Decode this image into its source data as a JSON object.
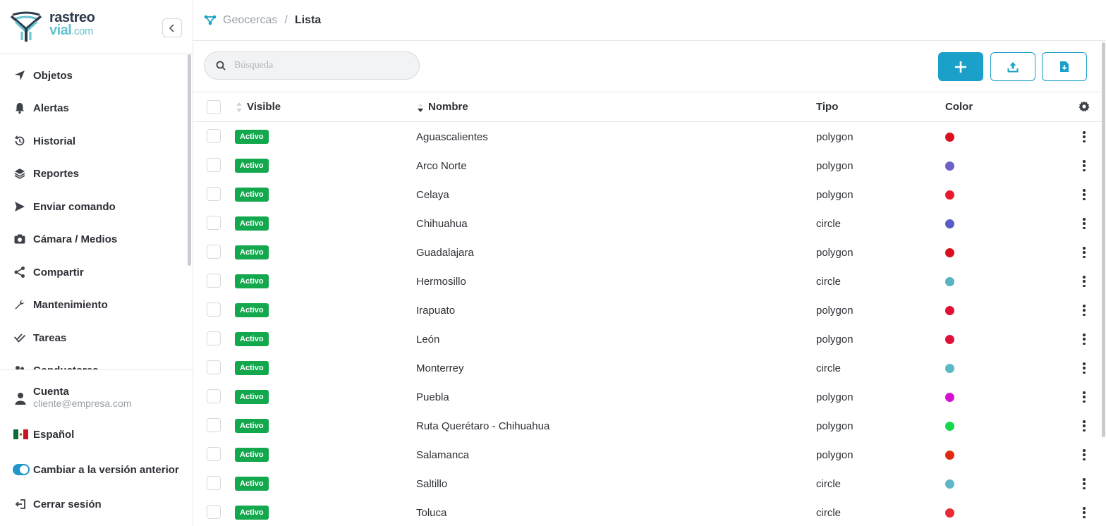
{
  "brand": {
    "line1": "rastreo",
    "line2_main": "vial",
    "line2_suffix": ".com"
  },
  "nav": {
    "items": [
      {
        "label": "Objetos",
        "icon": "location-arrow-icon"
      },
      {
        "label": "Alertas",
        "icon": "bell-icon"
      },
      {
        "label": "Historial",
        "icon": "history-icon"
      },
      {
        "label": "Reportes",
        "icon": "layers-icon"
      },
      {
        "label": "Enviar comando",
        "icon": "send-icon"
      },
      {
        "label": "Cámara / Medios",
        "icon": "camera-icon"
      },
      {
        "label": "Compartir",
        "icon": "share-icon"
      },
      {
        "label": "Mantenimiento",
        "icon": "wrench-icon"
      },
      {
        "label": "Tareas",
        "icon": "double-check-icon"
      },
      {
        "label": "Conductores",
        "icon": "users-icon"
      }
    ]
  },
  "account": {
    "label": "Cuenta",
    "email": "cliente@empresa.com"
  },
  "language": {
    "label": "Español"
  },
  "legacy_toggle": {
    "label": "Cambiar a la versión anterior",
    "on": true
  },
  "logout": {
    "label": "Cerrar sesión"
  },
  "breadcrumb": {
    "section": "Geocercas",
    "separator": "/",
    "page": "Lista"
  },
  "search": {
    "placeholder": "Búsqueda",
    "value": ""
  },
  "columns": {
    "visible": "Visible",
    "name": "Nombre",
    "type": "Tipo",
    "color": "Color"
  },
  "rows": [
    {
      "status": "Activo",
      "name": "Aguascalientes",
      "type": "polygon",
      "color": "#d90f1e"
    },
    {
      "status": "Activo",
      "name": "Arco Norte",
      "type": "polygon",
      "color": "#6a62c6"
    },
    {
      "status": "Activo",
      "name": "Celaya",
      "type": "polygon",
      "color": "#e8182e"
    },
    {
      "status": "Activo",
      "name": "Chihuahua",
      "type": "circle",
      "color": "#5b5cc4"
    },
    {
      "status": "Activo",
      "name": "Guadalajara",
      "type": "polygon",
      "color": "#d90f1e"
    },
    {
      "status": "Activo",
      "name": "Hermosillo",
      "type": "circle",
      "color": "#5bb2c2"
    },
    {
      "status": "Activo",
      "name": "Irapuato",
      "type": "polygon",
      "color": "#e01038"
    },
    {
      "status": "Activo",
      "name": "León",
      "type": "polygon",
      "color": "#e01038"
    },
    {
      "status": "Activo",
      "name": "Monterrey",
      "type": "circle",
      "color": "#5bb8c4"
    },
    {
      "status": "Activo",
      "name": "Puebla",
      "type": "polygon",
      "color": "#d612d0"
    },
    {
      "status": "Activo",
      "name": "Ruta Querétaro - Chihuahua",
      "type": "polygon",
      "color": "#12d84a"
    },
    {
      "status": "Activo",
      "name": "Salamanca",
      "type": "polygon",
      "color": "#e02a10"
    },
    {
      "status": "Activo",
      "name": "Saltillo",
      "type": "circle",
      "color": "#5bb8c4"
    },
    {
      "status": "Activo",
      "name": "Toluca",
      "type": "circle",
      "color": "#e82a36"
    }
  ],
  "colors": {
    "accent": "#1ba0c9",
    "badge": "#14a84e",
    "toggle": "#2196c9"
  }
}
